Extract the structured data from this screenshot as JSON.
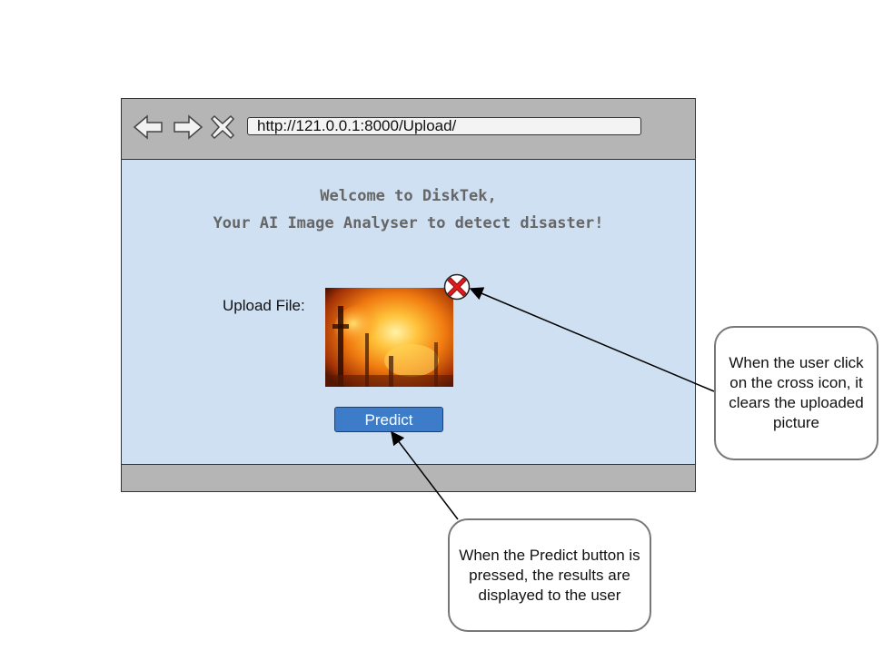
{
  "browser": {
    "url": "http://121.0.0.1:8000/Upload/",
    "nav_icons": [
      "back-arrow-icon",
      "forward-arrow-icon",
      "close-icon"
    ]
  },
  "page": {
    "welcome_line1": "Welcome to DiskTek,",
    "welcome_line2": "Your AI Image Analyser to detect disaster!",
    "upload_label": "Upload File:",
    "clear_icon": "red-cross-icon",
    "predict_label": "Predict"
  },
  "annotations": {
    "clear_note": "When the user click on the cross icon, it clears the uploaded picture",
    "predict_note": "When the Predict button is pressed, the results are displayed to the user"
  },
  "colors": {
    "chrome": "#b5b5b5",
    "page_background": "#cfe0f2",
    "button": "#3d7cc9",
    "cross": "#e01b1b"
  }
}
